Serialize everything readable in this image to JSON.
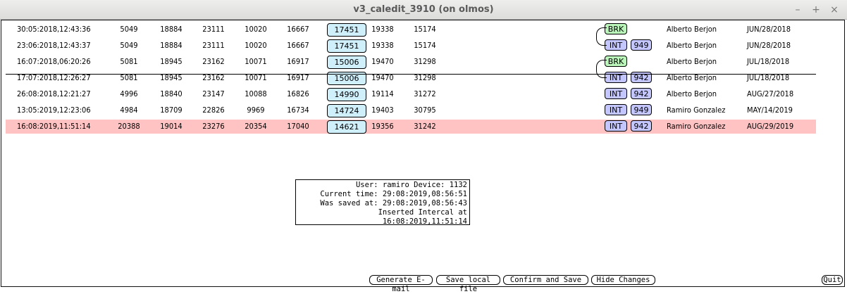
{
  "window": {
    "title": "v3_caledit_3910 (on olmos)",
    "minimize": "–",
    "maximize": "+",
    "close": "×"
  },
  "rows": [
    {
      "date": "30:05:2018,12:43:36",
      "n1": "5049",
      "n2": "18884",
      "n3": "23111",
      "n4": "10020",
      "n5": "16667",
      "boxed": "17451",
      "n6": "19338",
      "n7": "15174",
      "tag": "BRK",
      "device": "",
      "user": "Alberto Berjon",
      "date2": "JUN/28/2018"
    },
    {
      "date": "23:06:2018,12:43:37",
      "n1": "5049",
      "n2": "18884",
      "n3": "23111",
      "n4": "10020",
      "n5": "16667",
      "boxed": "17451",
      "n6": "19338",
      "n7": "15174",
      "tag": "INT",
      "device": "949",
      "user": "Alberto Berjon",
      "date2": "JUN/28/2018"
    },
    {
      "date": "16:07:2018,06:20:26",
      "n1": "5081",
      "n2": "18945",
      "n3": "23162",
      "n4": "10071",
      "n5": "16917",
      "boxed": "15006",
      "n6": "19470",
      "n7": "31298",
      "tag": "BRK",
      "device": "",
      "user": "Alberto Berjon",
      "date2": "JUL/18/2018"
    },
    {
      "date": "17:07:2018,12:26:27",
      "n1": "5081",
      "n2": "18945",
      "n3": "23162",
      "n4": "10071",
      "n5": "16917",
      "boxed": "15006",
      "n6": "19470",
      "n7": "31298",
      "tag": "INT",
      "device": "942",
      "user": "Alberto Berjon",
      "date2": "JUL/18/2018"
    },
    {
      "date": "26:08:2018,12:21:27",
      "n1": "4996",
      "n2": "18840",
      "n3": "23147",
      "n4": "10088",
      "n5": "16826",
      "boxed": "14990",
      "n6": "19114",
      "n7": "31272",
      "tag": "INT",
      "device": "942",
      "user": "Alberto Berjon",
      "date2": "AUG/27/2018"
    },
    {
      "date": "13:05:2019,12:23:06",
      "n1": "4984",
      "n2": "18709",
      "n3": "22826",
      "n4": "9969",
      "n5": "16734",
      "boxed": "14724",
      "n6": "19403",
      "n7": "30795",
      "tag": "INT",
      "device": "949",
      "user": "Ramiro Gonzalez",
      "date2": "MAY/14/2019"
    },
    {
      "date": "16:08:2019,11:51:14",
      "n1": "20388",
      "n2": "19014",
      "n3": "23276",
      "n4": "20354",
      "n5": "17040",
      "boxed": "14621",
      "n6": "19356",
      "n7": "31242",
      "tag": "INT",
      "device": "942",
      "user": "Ramiro Gonzalez",
      "date2": "AUG/29/2019"
    }
  ],
  "info": {
    "line1": "User: ramiro Device: 1132",
    "line2": "Current time: 29:08:2019,08:56:51",
    "line3": "Was saved at: 29:08:2019,08:56:43",
    "line4": "Inserted Intercal at 16:08:2019,11:51:14"
  },
  "buttons": {
    "generate_email": "Generate E-mail",
    "save_local": "Save local file",
    "confirm_save": "Confirm and Save",
    "hide_changes": "Hide Changes",
    "quit": "Quit"
  }
}
